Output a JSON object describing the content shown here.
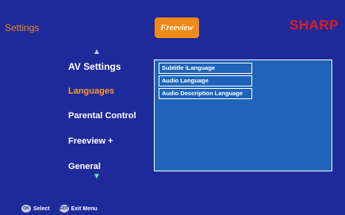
{
  "header": {
    "title": "Settings",
    "logo_text": "Freeview",
    "brand": "SHARP"
  },
  "menu": {
    "items": [
      {
        "label": "AV Settings"
      },
      {
        "label": "Languages"
      },
      {
        "label": "Parental Control"
      },
      {
        "label": "Freeview +"
      },
      {
        "label": "General"
      }
    ],
    "selected": "Languages",
    "up_icon": "triangle-up-icon",
    "down_icon": "triangle-down-icon"
  },
  "panel": {
    "options": [
      {
        "label": "Subtitle \\Language"
      },
      {
        "label": "Audio Language"
      },
      {
        "label": "Audio Description Language"
      }
    ]
  },
  "footer": {
    "ok_icon_text": "OK",
    "select_label": "Select",
    "exit_icon_text": "EXIT",
    "exit_label": "Exit Menu"
  },
  "colors": {
    "background": "#1f2a9a",
    "accent": "#f08a1a",
    "panel": "#1f64b8",
    "brand": "#e21d1d"
  }
}
